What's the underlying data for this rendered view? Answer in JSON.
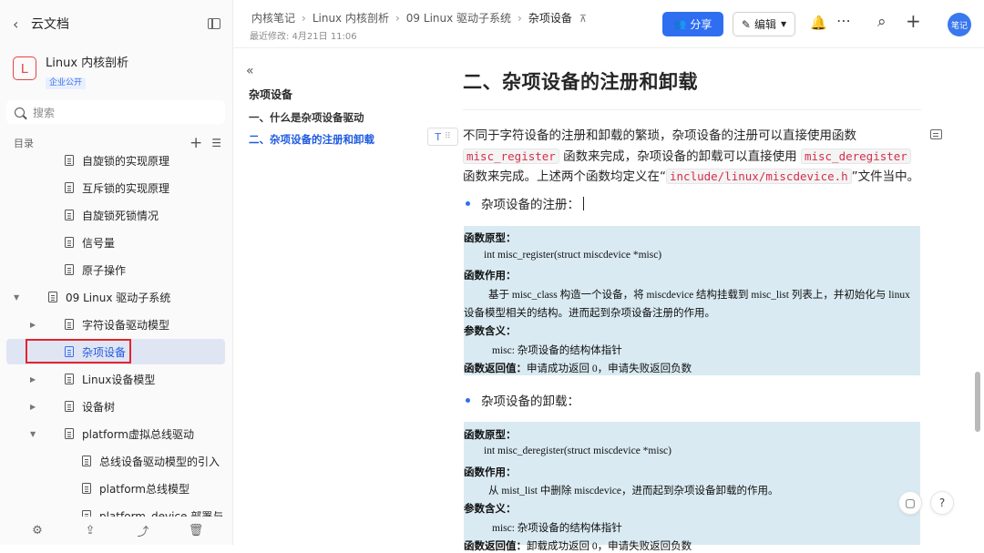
{
  "sidebar": {
    "back_title": "云文档",
    "book_logo": "L",
    "book_name": "Linux 内核剖析",
    "book_badge": "企业公开",
    "search_placeholder": "搜索",
    "toc_label": "目录",
    "tree": [
      {
        "label": "自旋锁的实现原理",
        "level": 1,
        "caret": ""
      },
      {
        "label": "互斥锁的实现原理",
        "level": 1,
        "caret": ""
      },
      {
        "label": "自旋锁死锁情况",
        "level": 1,
        "caret": ""
      },
      {
        "label": "信号量",
        "level": 1,
        "caret": ""
      },
      {
        "label": "原子操作",
        "level": 1,
        "caret": ""
      },
      {
        "label": "09 Linux 驱动子系统",
        "level": 0,
        "caret": "down"
      },
      {
        "label": "字符设备驱动模型",
        "level": 1,
        "caret": "right"
      },
      {
        "label": "杂项设备",
        "level": 1,
        "caret": "",
        "active": true
      },
      {
        "label": "Linux设备模型",
        "level": 1,
        "caret": "right"
      },
      {
        "label": "设备树",
        "level": 1,
        "caret": "right"
      },
      {
        "label": "platform虚拟总线驱动",
        "level": 1,
        "caret": "down"
      },
      {
        "label": "总线设备驱动模型的引入",
        "level": 2,
        "caret": ""
      },
      {
        "label": "platform总线模型",
        "level": 2,
        "caret": ""
      },
      {
        "label": "platform_device 部署与 d",
        "level": 2,
        "caret": ""
      }
    ]
  },
  "header": {
    "breadcrumb": [
      "内核笔记",
      "Linux 内核剖析",
      "09 Linux 驱动子系统",
      "杂项设备"
    ],
    "modified": "最近修改: 4月21日 11:06",
    "share_label": "分享",
    "edit_label": "编辑",
    "avatar_text": "笔记"
  },
  "outline": {
    "title": "杂项设备",
    "items": [
      {
        "label": "一、什么是杂项设备驱动",
        "active": false
      },
      {
        "label": "二、杂项设备的注册和卸载",
        "active": true
      }
    ]
  },
  "doc": {
    "heading": "二、杂项设备的注册和卸载",
    "para": {
      "t1": "不同于字符设备的注册和卸载的繁琐，杂项设备的注册可以直接使用函数",
      "c1": "misc_register",
      "t2": " 函数来完成，杂项设备的卸载可以直接使用 ",
      "c2": "misc_deregister",
      "t3": "函数来完成。上述两个函数均定义在“",
      "c3": "include/linux/miscdevice.h",
      "t4": "”文件当中。"
    },
    "bullet1": "杂项设备的注册：",
    "box1": {
      "l1": "函数原型：",
      "l2": "int misc_register(struct miscdevice *misc)",
      "l3": "函数作用：",
      "l4": "基于 misc_class 构造一个设备，将 miscdevice 结构挂载到 misc_list 列表上，并初始化与 linux",
      "l5": "设备模型相关的结构。进而起到杂项设备注册的作用。",
      "l6": "参数含义：",
      "l7": "misc: 杂项设备的结构体指针",
      "l8a": "函数返回值：",
      "l8b": "申请成功返回 0，申请失败返回负数"
    },
    "bullet2": "杂项设备的卸载：",
    "box2": {
      "l1": "函数原型：",
      "l2": "int misc_deregister(struct miscdevice *misc)",
      "l3": "函数作用：",
      "l4": "从 mist_list 中删除 miscdevice，进而起到杂项设备卸载的作用。",
      "l5": "参数含义：",
      "l6": "misc: 杂项设备的结构体指针",
      "l7a": "函数返回值：",
      "l7b": "卸载成功返回 0，申请失败返回负数"
    }
  }
}
